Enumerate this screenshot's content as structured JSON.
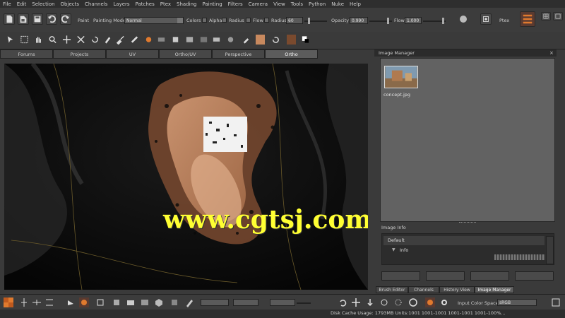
{
  "menu": [
    "File",
    "Edit",
    "Selection",
    "Objects",
    "Channels",
    "Layers",
    "Patches",
    "Ptex",
    "Shading",
    "Painting",
    "Filters",
    "Camera",
    "View",
    "Tools",
    "Python",
    "Nuke",
    "Help"
  ],
  "toolbar": {
    "paint_label": "Paint",
    "painting_mode_label": "Painting Mode",
    "painting_mode_value": "Normal",
    "colors_label": "Colors",
    "alpha_label": "Alpha",
    "radius_check_label": "Radius",
    "flow_check_label": "Flow",
    "radius_label": "Radius",
    "radius_value": "60",
    "opacity_label": "Opacity",
    "opacity_value": "0.990",
    "flow_label": "Flow",
    "flow_value": "1.000",
    "ptex_label": "Ptex"
  },
  "tabs": [
    {
      "label": "Forums",
      "active": false
    },
    {
      "label": "Projects",
      "active": false
    },
    {
      "label": "UV",
      "active": false
    },
    {
      "label": "Ortho/UV",
      "active": false
    },
    {
      "label": "Perspective",
      "active": false
    },
    {
      "label": "Ortho",
      "active": true
    }
  ],
  "viewport": {
    "watermark": "www.cgtsj.com"
  },
  "image_manager": {
    "title": "Image Manager",
    "thumbnail_label": "concept.jpg"
  },
  "image_info": {
    "title": "Image Info",
    "default_label": "Default",
    "info_label": "Info"
  },
  "right_tabs": [
    {
      "label": "Brush Editor",
      "active": false
    },
    {
      "label": "Channels",
      "active": false
    },
    {
      "label": "History View",
      "active": false
    },
    {
      "label": "Image Manager",
      "active": true
    }
  ],
  "bottom": {
    "color_space_label": "Input Color Space",
    "color_space_value": "sRGB",
    "status": "Disk Cache Usage: 1793MB  Units:1001  1001-1001  1001-1001  1001-100%..."
  },
  "colors": {
    "swatch1": "#c8895e",
    "swatch2": "#7a4a2e",
    "accent": "#e07a2e",
    "watermark": "#ffff33"
  }
}
